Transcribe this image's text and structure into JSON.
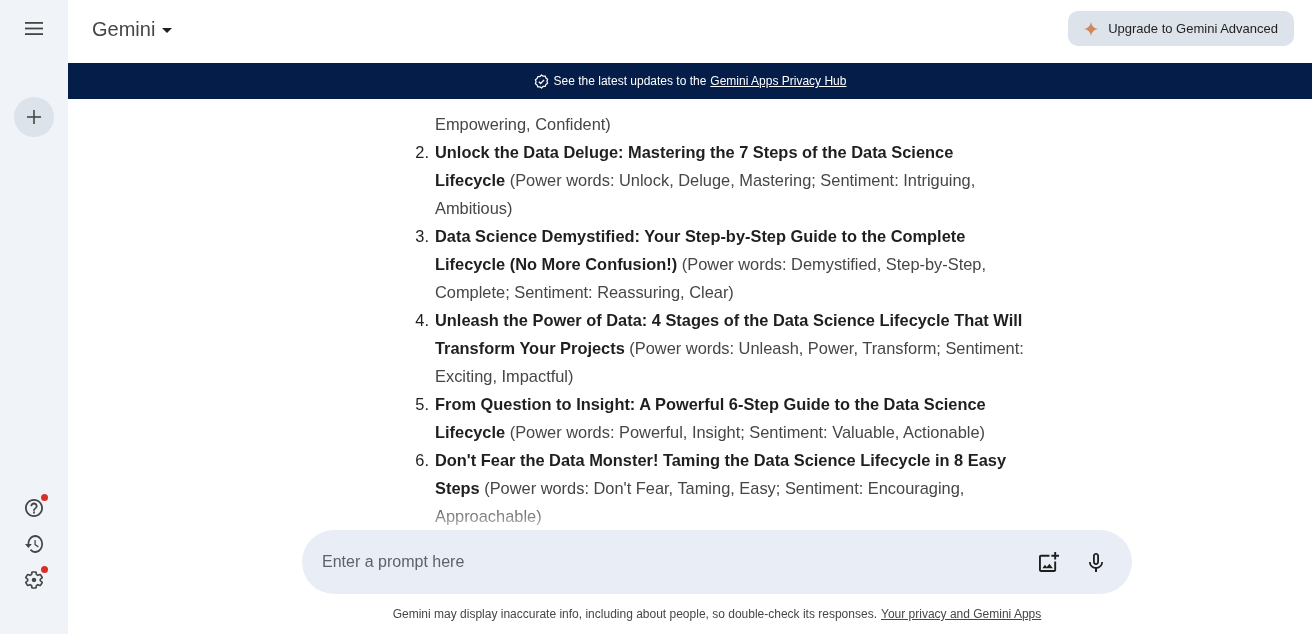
{
  "sidebar": {
    "bottom_items": [
      {
        "kind": "help",
        "badge": true
      },
      {
        "kind": "history",
        "badge": false
      },
      {
        "kind": "settings",
        "badge": true
      }
    ]
  },
  "header": {
    "title": "Gemini",
    "upgrade_button": "Upgrade to Gemini Advanced"
  },
  "banner": {
    "text": "See the latest updates to the",
    "link": "Gemini Apps Privacy Hub"
  },
  "response": {
    "items": [
      {
        "text": "Empowering, Confident)"
      },
      {
        "number": "2.",
        "text": "**Unlock the Data Deluge: Mastering the 7 Steps of the Data Science Lifecycle** (Power words: Unlock, Deluge, Mastering; Sentiment: Intriguing, Ambitious)"
      },
      {
        "number": "3.",
        "text": "**Data Science Demystified: Your Step-by-Step Guide to the Complete Lifecycle (No More Confusion!)** (Power words: Demystified, Step-by-Step, Complete; Sentiment: Reassuring, Clear)"
      },
      {
        "number": "4.",
        "text": "**Unleash the Power of Data: 4 Stages of the Data Science Lifecycle That Will Transform Your Projects** (Power words: Unleash, Power, Transform; Sentiment: Exciting, Impactful)"
      },
      {
        "number": "5.",
        "text": "**From Question to Insight: A Powerful 6-Step Guide to the Data Science Lifecycle** (Power words: Powerful, Insight; Sentiment: Valuable, Actionable)"
      },
      {
        "number": "6.",
        "text": "**Don't Fear the Data Monster! Taming the Data Science Lifecycle in 8 Easy Steps** (Power words: Don't Fear, Taming, Easy; Sentiment: Encouraging, Approachable)"
      }
    ]
  },
  "prompt": {
    "placeholder": "Enter a prompt here"
  },
  "footer": {
    "text": "Gemini may display inaccurate info, including about people, so double-check its responses.",
    "link": "Your privacy and Gemini Apps"
  }
}
